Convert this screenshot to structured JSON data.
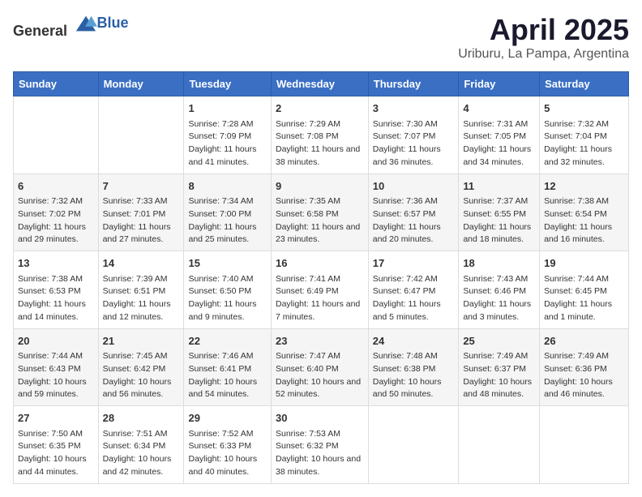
{
  "logo": {
    "general": "General",
    "blue": "Blue"
  },
  "title": "April 2025",
  "subtitle": "Uriburu, La Pampa, Argentina",
  "days_header": [
    "Sunday",
    "Monday",
    "Tuesday",
    "Wednesday",
    "Thursday",
    "Friday",
    "Saturday"
  ],
  "weeks": [
    [
      {
        "day": "",
        "info": ""
      },
      {
        "day": "",
        "info": ""
      },
      {
        "day": "1",
        "info": "Sunrise: 7:28 AM\nSunset: 7:09 PM\nDaylight: 11 hours and 41 minutes."
      },
      {
        "day": "2",
        "info": "Sunrise: 7:29 AM\nSunset: 7:08 PM\nDaylight: 11 hours and 38 minutes."
      },
      {
        "day": "3",
        "info": "Sunrise: 7:30 AM\nSunset: 7:07 PM\nDaylight: 11 hours and 36 minutes."
      },
      {
        "day": "4",
        "info": "Sunrise: 7:31 AM\nSunset: 7:05 PM\nDaylight: 11 hours and 34 minutes."
      },
      {
        "day": "5",
        "info": "Sunrise: 7:32 AM\nSunset: 7:04 PM\nDaylight: 11 hours and 32 minutes."
      }
    ],
    [
      {
        "day": "6",
        "info": "Sunrise: 7:32 AM\nSunset: 7:02 PM\nDaylight: 11 hours and 29 minutes."
      },
      {
        "day": "7",
        "info": "Sunrise: 7:33 AM\nSunset: 7:01 PM\nDaylight: 11 hours and 27 minutes."
      },
      {
        "day": "8",
        "info": "Sunrise: 7:34 AM\nSunset: 7:00 PM\nDaylight: 11 hours and 25 minutes."
      },
      {
        "day": "9",
        "info": "Sunrise: 7:35 AM\nSunset: 6:58 PM\nDaylight: 11 hours and 23 minutes."
      },
      {
        "day": "10",
        "info": "Sunrise: 7:36 AM\nSunset: 6:57 PM\nDaylight: 11 hours and 20 minutes."
      },
      {
        "day": "11",
        "info": "Sunrise: 7:37 AM\nSunset: 6:55 PM\nDaylight: 11 hours and 18 minutes."
      },
      {
        "day": "12",
        "info": "Sunrise: 7:38 AM\nSunset: 6:54 PM\nDaylight: 11 hours and 16 minutes."
      }
    ],
    [
      {
        "day": "13",
        "info": "Sunrise: 7:38 AM\nSunset: 6:53 PM\nDaylight: 11 hours and 14 minutes."
      },
      {
        "day": "14",
        "info": "Sunrise: 7:39 AM\nSunset: 6:51 PM\nDaylight: 11 hours and 12 minutes."
      },
      {
        "day": "15",
        "info": "Sunrise: 7:40 AM\nSunset: 6:50 PM\nDaylight: 11 hours and 9 minutes."
      },
      {
        "day": "16",
        "info": "Sunrise: 7:41 AM\nSunset: 6:49 PM\nDaylight: 11 hours and 7 minutes."
      },
      {
        "day": "17",
        "info": "Sunrise: 7:42 AM\nSunset: 6:47 PM\nDaylight: 11 hours and 5 minutes."
      },
      {
        "day": "18",
        "info": "Sunrise: 7:43 AM\nSunset: 6:46 PM\nDaylight: 11 hours and 3 minutes."
      },
      {
        "day": "19",
        "info": "Sunrise: 7:44 AM\nSunset: 6:45 PM\nDaylight: 11 hours and 1 minute."
      }
    ],
    [
      {
        "day": "20",
        "info": "Sunrise: 7:44 AM\nSunset: 6:43 PM\nDaylight: 10 hours and 59 minutes."
      },
      {
        "day": "21",
        "info": "Sunrise: 7:45 AM\nSunset: 6:42 PM\nDaylight: 10 hours and 56 minutes."
      },
      {
        "day": "22",
        "info": "Sunrise: 7:46 AM\nSunset: 6:41 PM\nDaylight: 10 hours and 54 minutes."
      },
      {
        "day": "23",
        "info": "Sunrise: 7:47 AM\nSunset: 6:40 PM\nDaylight: 10 hours and 52 minutes."
      },
      {
        "day": "24",
        "info": "Sunrise: 7:48 AM\nSunset: 6:38 PM\nDaylight: 10 hours and 50 minutes."
      },
      {
        "day": "25",
        "info": "Sunrise: 7:49 AM\nSunset: 6:37 PM\nDaylight: 10 hours and 48 minutes."
      },
      {
        "day": "26",
        "info": "Sunrise: 7:49 AM\nSunset: 6:36 PM\nDaylight: 10 hours and 46 minutes."
      }
    ],
    [
      {
        "day": "27",
        "info": "Sunrise: 7:50 AM\nSunset: 6:35 PM\nDaylight: 10 hours and 44 minutes."
      },
      {
        "day": "28",
        "info": "Sunrise: 7:51 AM\nSunset: 6:34 PM\nDaylight: 10 hours and 42 minutes."
      },
      {
        "day": "29",
        "info": "Sunrise: 7:52 AM\nSunset: 6:33 PM\nDaylight: 10 hours and 40 minutes."
      },
      {
        "day": "30",
        "info": "Sunrise: 7:53 AM\nSunset: 6:32 PM\nDaylight: 10 hours and 38 minutes."
      },
      {
        "day": "",
        "info": ""
      },
      {
        "day": "",
        "info": ""
      },
      {
        "day": "",
        "info": ""
      }
    ]
  ]
}
